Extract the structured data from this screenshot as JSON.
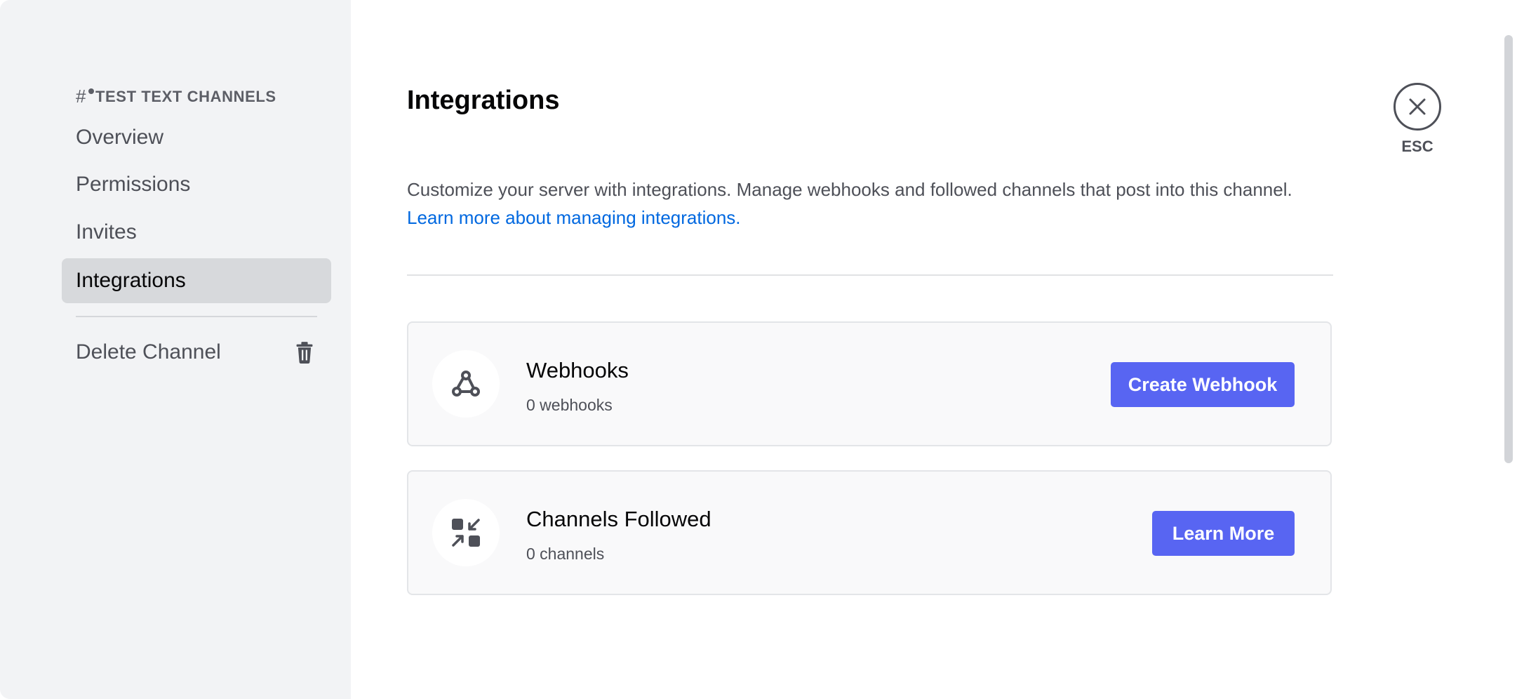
{
  "sidebar": {
    "channel_name": "TEST TEXT CHANNELS",
    "items": [
      {
        "label": "Overview"
      },
      {
        "label": "Permissions"
      },
      {
        "label": "Invites"
      },
      {
        "label": "Integrations",
        "active": true
      }
    ],
    "delete_label": "Delete Channel"
  },
  "main": {
    "title": "Integrations",
    "description": "Customize your server with integrations. Manage webhooks and followed channels that post into this channel.",
    "learn_link": "Learn more about managing integrations.",
    "cards": [
      {
        "title": "Webhooks",
        "subtitle": "0 webhooks",
        "button": "Create Webhook",
        "icon": "webhook-icon"
      },
      {
        "title": "Channels Followed",
        "subtitle": "0 channels",
        "button": "Learn More",
        "icon": "channel-follow-icon"
      }
    ]
  },
  "close": {
    "label": "ESC"
  },
  "colors": {
    "accent": "#5865f2",
    "link": "#0068e0",
    "annotation": "#ff1ee6"
  }
}
